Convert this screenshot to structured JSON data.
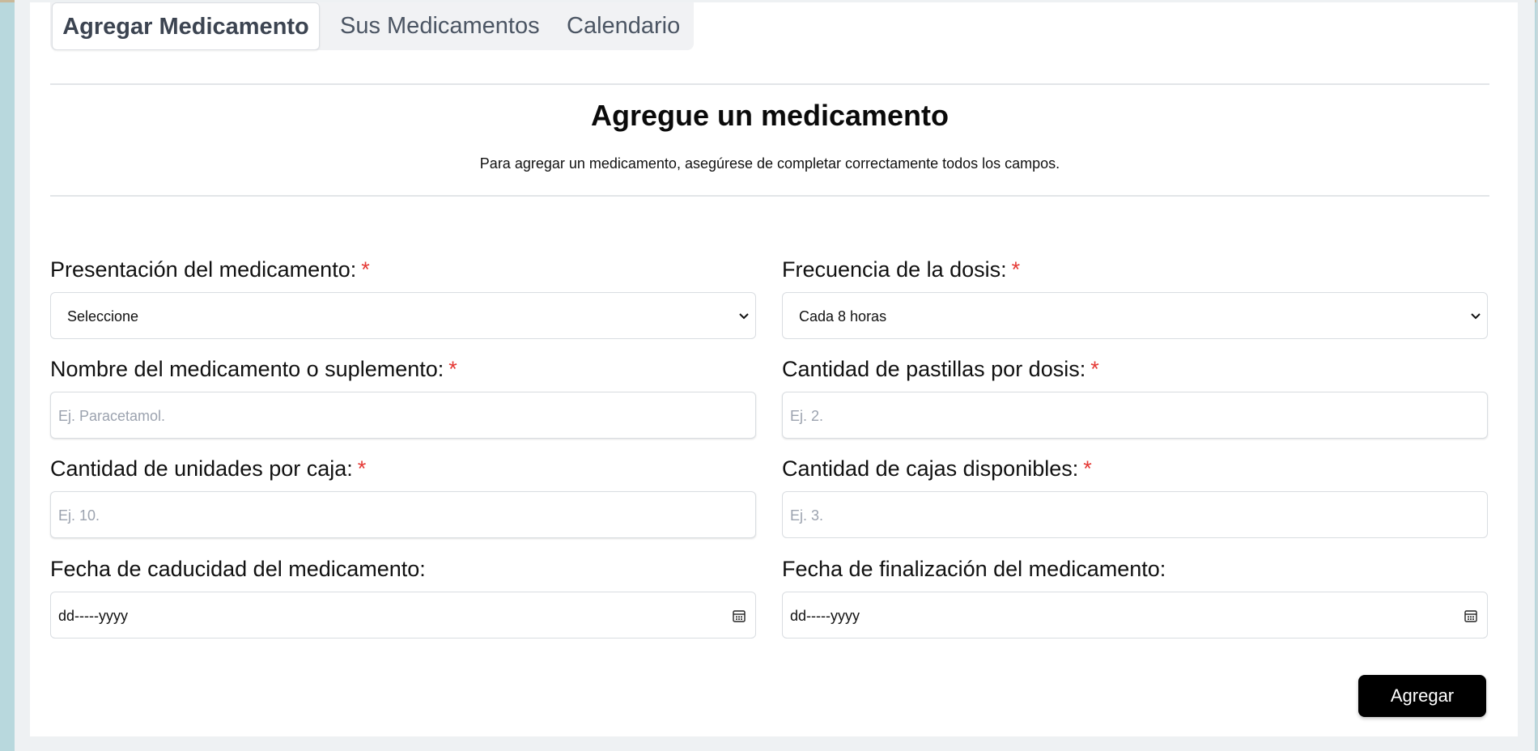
{
  "tabs": [
    {
      "label": "Agregar Medicamento",
      "active": true
    },
    {
      "label": "Sus Medicamentos",
      "active": false
    },
    {
      "label": "Calendario",
      "active": false
    }
  ],
  "header": {
    "title": "Agregue un medicamento",
    "subtitle": "Para agregar un medicamento, asegúrese de completar correctamente todos los campos."
  },
  "form": {
    "required_marker": "*",
    "presentation": {
      "label": "Presentación del medicamento:",
      "value": "Seleccione"
    },
    "frequency": {
      "label": "Frecuencia de la dosis:",
      "value": "Cada 8 horas"
    },
    "name": {
      "label": "Nombre del medicamento o suplemento:",
      "placeholder": "Ej. Paracetamol."
    },
    "pills_per_dose": {
      "label": "Cantidad de pastillas por dosis:",
      "placeholder": "Ej. 2."
    },
    "units_per_box": {
      "label": "Cantidad de unidades por caja:",
      "placeholder": "Ej. 10."
    },
    "boxes_available": {
      "label": "Cantidad de cajas disponibles:",
      "placeholder": "Ej. 3."
    },
    "expiry_date": {
      "label": "Fecha de caducidad del medicamento:",
      "value": "dd-----yyyy"
    },
    "end_date": {
      "label": "Fecha de finalización del medicamento:",
      "value": "dd-----yyyy"
    },
    "submit_label": "Agregar"
  },
  "colors": {
    "required": "#e53935",
    "button_bg": "#000000",
    "page_bg": "#b8d8dd"
  }
}
